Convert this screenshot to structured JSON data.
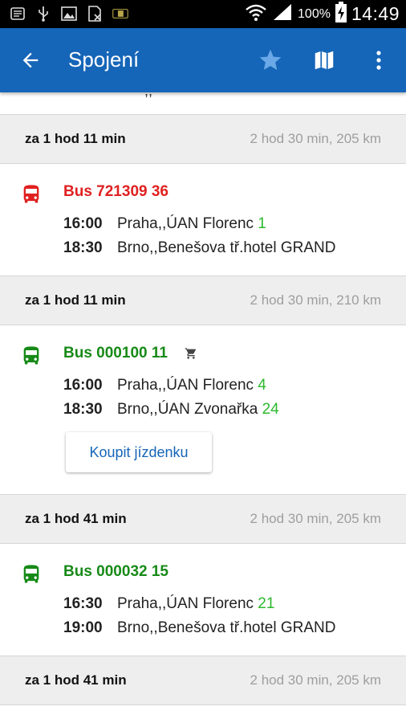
{
  "status_bar": {
    "battery": "100%",
    "time": "14:49"
  },
  "app_bar": {
    "title": "Spojení"
  },
  "colors": {
    "app_bar": "#1565b8",
    "red_line": "#e02020",
    "green_line": "#178a17",
    "platform": "#2db82d"
  },
  "partial_top": ",,",
  "connections": [
    {
      "departs_in": "za 1 hod 11 min",
      "summary": "2 hod 30 min, 205 km",
      "line": "Bus 721309 36",
      "line_color": "red",
      "stops": [
        {
          "time": "16:00",
          "name": "Praha,,ÚAN Florenc",
          "platform": "1"
        },
        {
          "time": "18:30",
          "name": "Brno,,Benešova tř.hotel GRAND",
          "platform": ""
        }
      ]
    },
    {
      "departs_in": "za 1 hod 11 min",
      "summary": "2 hod 30 min, 210 km",
      "line": "Bus 000100 11",
      "line_color": "green",
      "stops": [
        {
          "time": "16:00",
          "name": "Praha,,ÚAN Florenc",
          "platform": "4"
        },
        {
          "time": "18:30",
          "name": "Brno,,ÚAN Zvonařka",
          "platform": "24"
        }
      ],
      "buy_label": "Koupit jízdenku"
    },
    {
      "departs_in": "za 1 hod 41 min",
      "summary": "2 hod 30 min, 205 km",
      "line": "Bus 000032 15",
      "line_color": "green",
      "stops": [
        {
          "time": "16:30",
          "name": "Praha,,ÚAN Florenc",
          "platform": "21"
        },
        {
          "time": "19:00",
          "name": "Brno,,Benešova tř.hotel GRAND",
          "platform": ""
        }
      ]
    },
    {
      "departs_in": "za 1 hod 41 min",
      "summary": "2 hod 30 min, 205 km"
    }
  ]
}
